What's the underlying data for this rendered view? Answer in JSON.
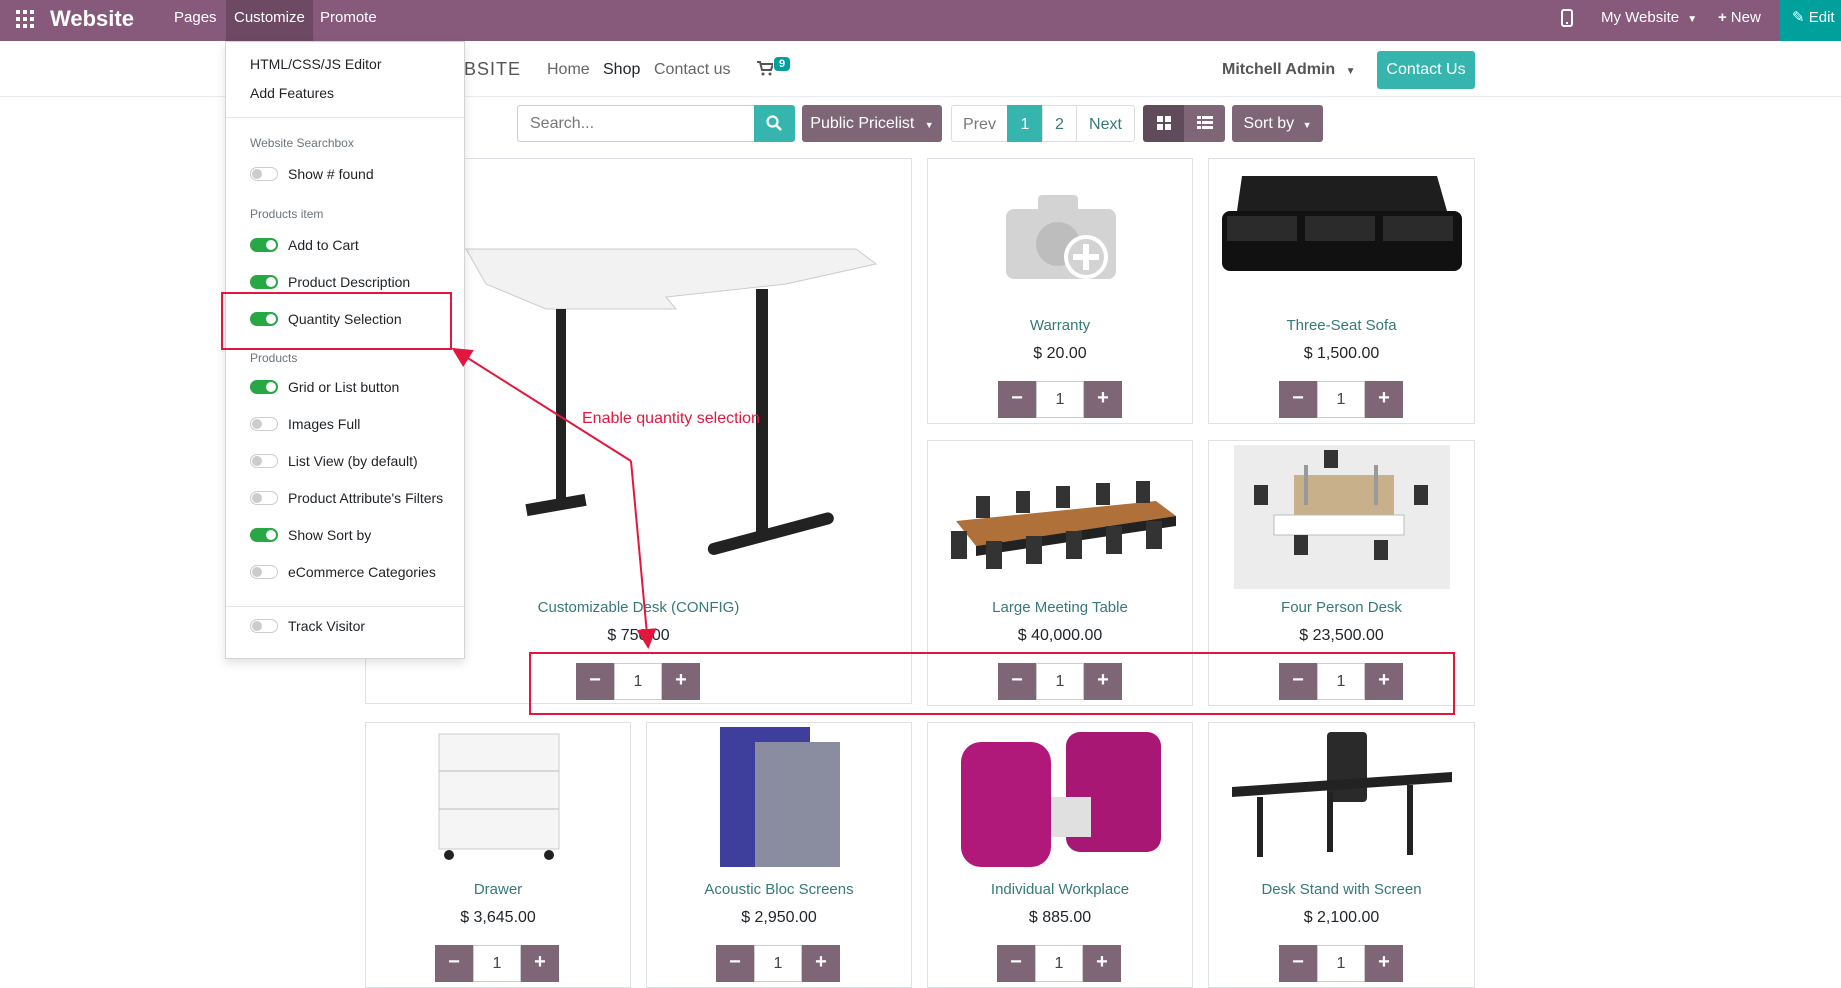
{
  "topbar": {
    "brand": "Website",
    "menus": [
      "Pages",
      "Customize",
      "Promote"
    ],
    "my_website": "My Website",
    "new": "New",
    "edit": "Edit"
  },
  "header": {
    "logo_fragment": "EBSITE",
    "nav": [
      "Home",
      "Shop",
      "Contact us"
    ],
    "cart_count": "9",
    "user": "Mitchell Admin",
    "contact_button": "Contact Us"
  },
  "toolbar": {
    "search_placeholder": "Search...",
    "pricelist": "Public Pricelist",
    "pager": [
      "Prev",
      "1",
      "2",
      "Next"
    ],
    "sort": "Sort by"
  },
  "customize_menu": {
    "items": [
      "HTML/CSS/JS Editor",
      "Add Features"
    ],
    "section_searchbox": "Website Searchbox",
    "show_found": "Show # found",
    "section_products_item": "Products item",
    "add_to_cart": "Add to Cart",
    "product_description": "Product Description",
    "quantity_selection": "Quantity Selection",
    "section_products": "Products",
    "grid_or_list": "Grid or List button",
    "images_full": "Images Full",
    "list_view": "List View (by default)",
    "attr_filters": "Product Attribute's Filters",
    "show_sort": "Show Sort by",
    "ecommerce_categories": "eCommerce Categories",
    "track_visitor": "Track Visitor",
    "toggle_states": {
      "show_found": false,
      "add_to_cart": true,
      "product_description": true,
      "quantity_selection": true,
      "grid_or_list": true,
      "images_full": false,
      "list_view": false,
      "attr_filters": false,
      "show_sort": true,
      "ecommerce_categories": false,
      "track_visitor": false
    }
  },
  "products": [
    {
      "name": "Customizable Desk (CONFIG)",
      "price": "$ 750.00",
      "qty": "1"
    },
    {
      "name": "Warranty",
      "price": "$ 20.00",
      "qty": "1"
    },
    {
      "name": "Three-Seat Sofa",
      "price": "$ 1,500.00",
      "qty": "1"
    },
    {
      "name": "Large Meeting Table",
      "price": "$ 40,000.00",
      "qty": "1"
    },
    {
      "name": "Four Person Desk",
      "price": "$ 23,500.00",
      "qty": "1"
    },
    {
      "name": "Drawer",
      "price": "$ 3,645.00",
      "qty": "1"
    },
    {
      "name": "Acoustic Bloc Screens",
      "price": "$ 2,950.00",
      "qty": "1"
    },
    {
      "name": "Individual Workplace",
      "price": "$ 885.00",
      "qty": "1"
    },
    {
      "name": "Desk Stand with Screen",
      "price": "$ 2,100.00",
      "qty": "1"
    }
  ],
  "annotation": {
    "text": "Enable quantity selection"
  },
  "colors": {
    "admin_bar": "#875a7b",
    "teal": "#00a09d",
    "button_purple": "#7f6677",
    "annotation_red": "#e3173e"
  }
}
